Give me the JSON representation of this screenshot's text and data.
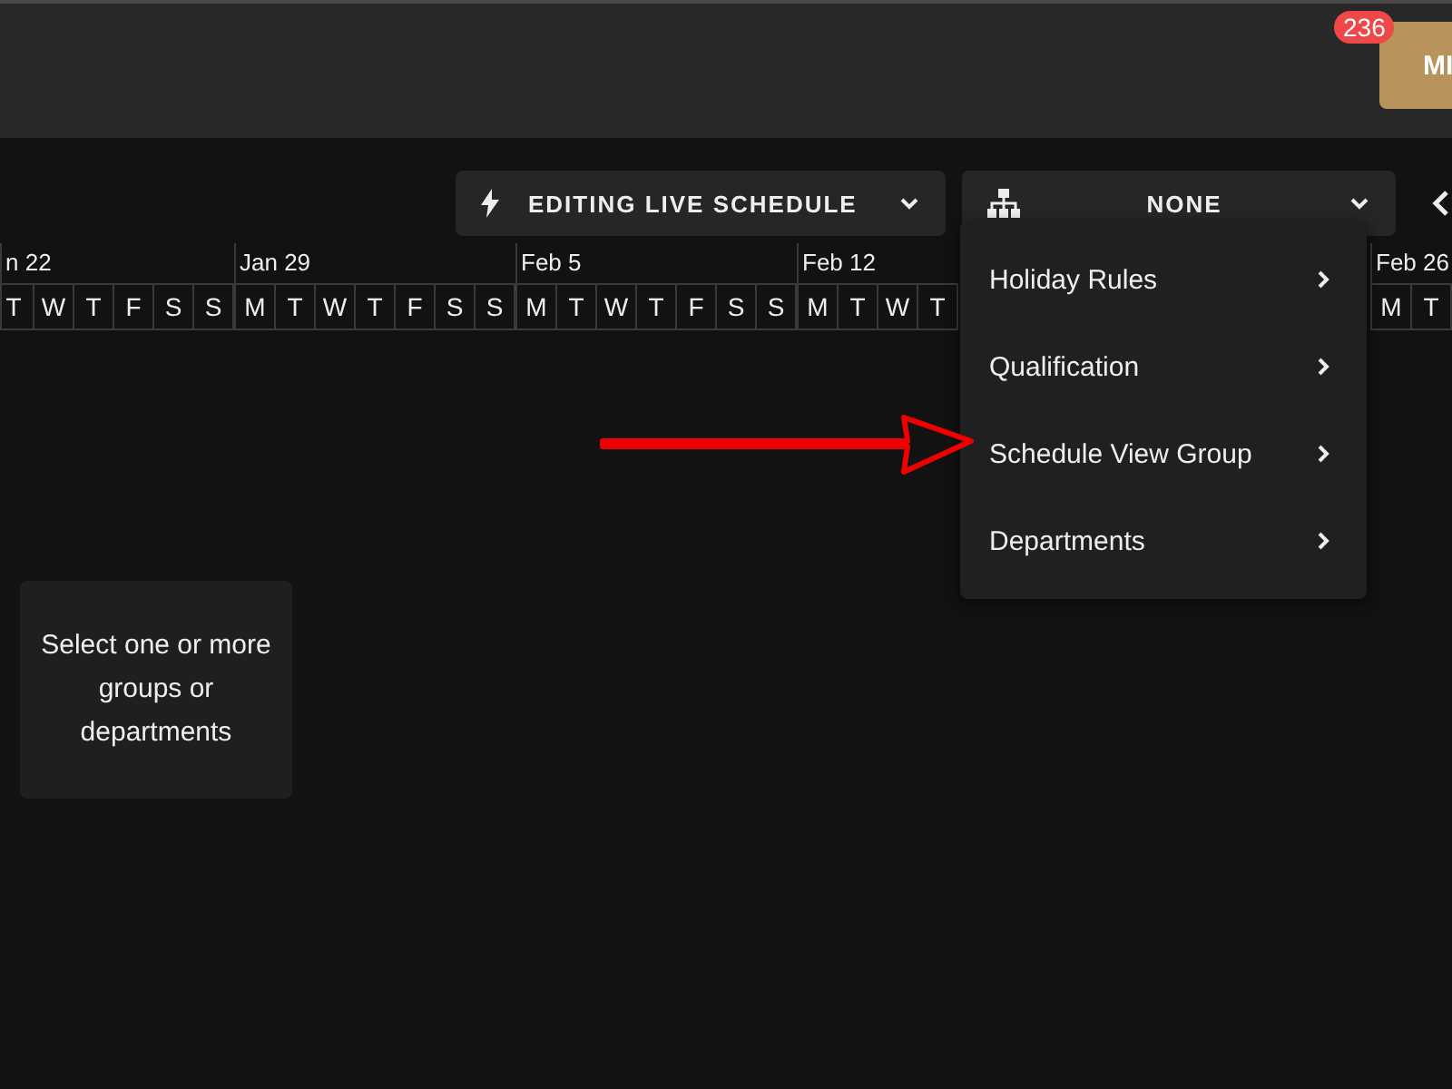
{
  "header": {
    "badge": "236",
    "user_button": "MI"
  },
  "toolbar": {
    "mode_button": {
      "label": "EDITING LIVE SCHEDULE"
    },
    "group_select": {
      "label": "NONE",
      "expanded": true
    }
  },
  "timeline": {
    "weeks": [
      {
        "label": "n 22",
        "days": [
          "T",
          "W",
          "T",
          "F",
          "S",
          "S"
        ]
      },
      {
        "label": "Jan 29",
        "days": [
          "M",
          "T",
          "W",
          "T",
          "F",
          "S",
          "S"
        ]
      },
      {
        "label": "Feb 5",
        "days": [
          "M",
          "T",
          "W",
          "T",
          "F",
          "S",
          "S"
        ]
      },
      {
        "label": "Feb 12",
        "days": [
          "M",
          "T",
          "W",
          "T"
        ]
      },
      {
        "label": "Feb 26",
        "days": [
          "M",
          "T"
        ]
      }
    ]
  },
  "dropdown_menu": {
    "items": [
      {
        "label": "Holiday Rules"
      },
      {
        "label": "Qualification"
      },
      {
        "label": "Schedule View Group"
      },
      {
        "label": "Departments"
      }
    ]
  },
  "empty_state": {
    "message": "Select one or more groups or departments"
  }
}
